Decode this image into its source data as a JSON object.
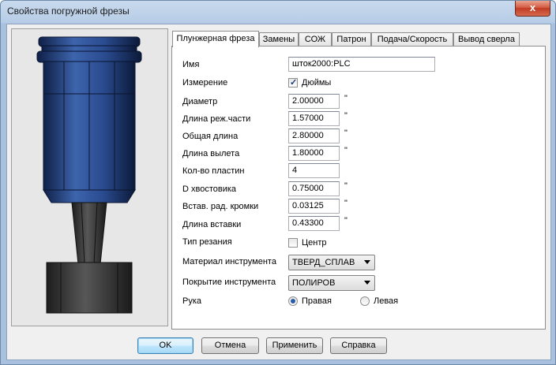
{
  "window": {
    "title": "Свойства погружной фрезы",
    "close_glyph": "x"
  },
  "tabs": [
    {
      "label": "Плунжерная фреза",
      "active": true
    },
    {
      "label": "Замены"
    },
    {
      "label": "СОЖ"
    },
    {
      "label": "Патрон"
    },
    {
      "label": "Подача/Скорость"
    },
    {
      "label": "Вывод сверла"
    }
  ],
  "form": {
    "name": {
      "label": "Имя",
      "value": "шток2000:PLC"
    },
    "measure": {
      "label": "Измерение",
      "checkbox_label": "Дюймы",
      "checked": true
    },
    "diameter": {
      "label": "Диаметр",
      "value": "2.00000",
      "unit": "\""
    },
    "cut_length": {
      "label": "Длина реж.части",
      "value": "1.57000",
      "unit": "\""
    },
    "total_length": {
      "label": "Общая длина",
      "value": "2.80000",
      "unit": "\""
    },
    "overhang_length": {
      "label": "Длина вылета",
      "value": "1.80000",
      "unit": "\""
    },
    "inserts": {
      "label": "Кол-во пластин",
      "value": "4"
    },
    "shank_d": {
      "label": "D хвостовика",
      "value": "0.75000",
      "unit": "\""
    },
    "insert_radius": {
      "label": "Встав. рад. кромки",
      "value": "0.03125",
      "unit": "\""
    },
    "insert_length": {
      "label": "Длина вставки",
      "value": "0.43300",
      "unit": "\""
    },
    "cut_type": {
      "label": "Тип резания",
      "checkbox_label": "Центр",
      "checked": false
    },
    "material": {
      "label": "Материал инструмента",
      "value": "ТВЕРД_СПЛАВ"
    },
    "coating": {
      "label": "Покрытие инструмента",
      "value": "ПОЛИРОВ"
    },
    "hand": {
      "label": "Рука",
      "right": "Правая",
      "left": "Левая",
      "selected": "right"
    }
  },
  "buttons": {
    "ok": "OK",
    "cancel": "Отмена",
    "apply": "Применить",
    "help": "Справка"
  },
  "colors": {
    "tool_blue": "#2e4f8f",
    "tool_dark": "#3a3a3a",
    "accent": "#3c7fb1"
  },
  "icons": {
    "close": "close-icon",
    "check": "check-icon",
    "dropdown": "chevron-down-icon"
  }
}
